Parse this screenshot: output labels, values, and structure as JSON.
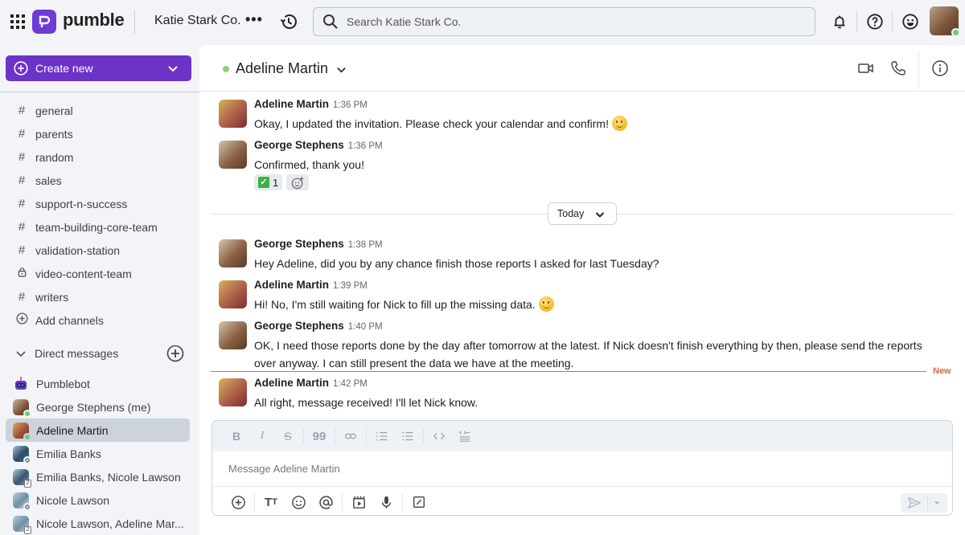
{
  "app": {
    "brand": "pumble",
    "brand_color": "#6e3bd6",
    "workspace": "Katie Stark Co."
  },
  "search": {
    "placeholder": "Search Katie Stark Co."
  },
  "sidebar": {
    "create_label": "Create new",
    "channels": [
      {
        "label": "general",
        "icon": "hash-icon"
      },
      {
        "label": "parents",
        "icon": "hash-icon"
      },
      {
        "label": "random",
        "icon": "hash-icon"
      },
      {
        "label": "sales",
        "icon": "hash-icon"
      },
      {
        "label": "support-n-success",
        "icon": "hash-icon"
      },
      {
        "label": "team-building-core-team",
        "icon": "hash-icon"
      },
      {
        "label": "validation-station",
        "icon": "hash-icon"
      },
      {
        "label": "video-content-team",
        "icon": "lock-icon"
      },
      {
        "label": "writers",
        "icon": "hash-icon"
      },
      {
        "label": "Add channels",
        "icon": "plus-circle-icon"
      }
    ],
    "dm_header": "Direct messages",
    "dms": [
      {
        "label": "Pumblebot",
        "status": "bot"
      },
      {
        "label": "George Stephens (me)",
        "status": "online"
      },
      {
        "label": "Adeline Martin",
        "status": "online",
        "active": true
      },
      {
        "label": "Emilia Banks",
        "status": "offline"
      },
      {
        "label": "Emilia Banks, Nicole Lawson",
        "status": "group",
        "count": "2"
      },
      {
        "label": "Nicole Lawson",
        "status": "offline"
      },
      {
        "label": "Nicole Lawson, Adeline Mar...",
        "status": "group",
        "count": "2"
      }
    ]
  },
  "chat": {
    "title": "Adeline Martin",
    "date_divider": "Today",
    "new_label": "New",
    "messages": [
      {
        "author": "Adeline Martin",
        "time": "1:36 PM",
        "text": "Okay, I updated the invitation. Please check your calendar and confirm!",
        "emoji": "slightly-smiling-face"
      },
      {
        "author": "George Stephens",
        "time": "1:36 PM",
        "text": "Confirmed, thank you!",
        "reactions": [
          {
            "emoji": "white-check-mark",
            "count": "1"
          }
        ]
      },
      {
        "author": "George Stephens",
        "time": "1:38 PM",
        "text": "Hey Adeline, did you by any chance finish those reports I asked for last Tuesday?"
      },
      {
        "author": "Adeline Martin",
        "time": "1:39 PM",
        "text": "Hi! No, I'm still waiting for Nick to fill up the missing data.",
        "emoji": "slightly-smiling-face"
      },
      {
        "author": "George Stephens",
        "time": "1:40 PM",
        "text": "OK, I need those reports done by the day after tomorrow at the latest. If Nick doesn't finish everything by then, please send the reports over anyway. I can still present the data we have at the meeting."
      },
      {
        "author": "Adeline Martin",
        "time": "1:42 PM",
        "text": "All right, message received! I'll let Nick know."
      }
    ]
  },
  "composer": {
    "placeholder": "Message Adeline Martin",
    "value": ""
  }
}
